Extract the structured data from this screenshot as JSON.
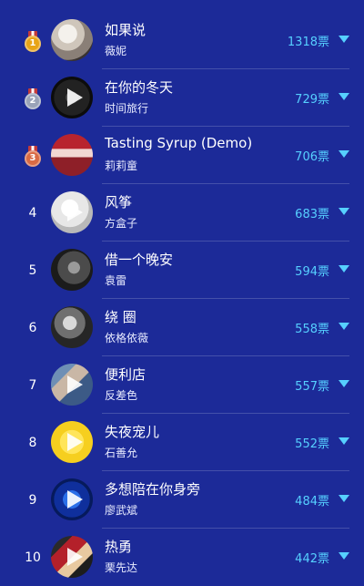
{
  "songs": [
    {
      "rank": "1",
      "title": "如果说",
      "artist": "薇妮",
      "votes": "1318票",
      "medal": "gold"
    },
    {
      "rank": "2",
      "title": "在你的冬天",
      "artist": "时间旅行",
      "votes": "729票",
      "medal": "silver"
    },
    {
      "rank": "3",
      "title": "Tasting Syrup (Demo)",
      "artist": "莉莉童",
      "votes": "706票",
      "medal": "bronze"
    },
    {
      "rank": "4",
      "title": "风筝",
      "artist": "方盒子",
      "votes": "683票"
    },
    {
      "rank": "5",
      "title": "借一个晚安",
      "artist": "袁雷",
      "votes": "594票"
    },
    {
      "rank": "6",
      "title": "绕 圈",
      "artist": "依格依薇",
      "votes": "558票"
    },
    {
      "rank": "7",
      "title": "便利店",
      "artist": "反差色",
      "votes": "557票"
    },
    {
      "rank": "8",
      "title": "失夜宠儿",
      "artist": "石善允",
      "votes": "552票"
    },
    {
      "rank": "9",
      "title": "多想陪在你身旁",
      "artist": "廖武斌",
      "votes": "484票"
    },
    {
      "rank": "10",
      "title": "热勇",
      "artist": "栗先达",
      "votes": "442票"
    }
  ],
  "colors": {
    "background": "#1c2a98",
    "vote_accent": "#56d0ff",
    "medal_gold": "#e8a417",
    "medal_silver": "#9aa3b8",
    "medal_bronze": "#d96a44"
  }
}
